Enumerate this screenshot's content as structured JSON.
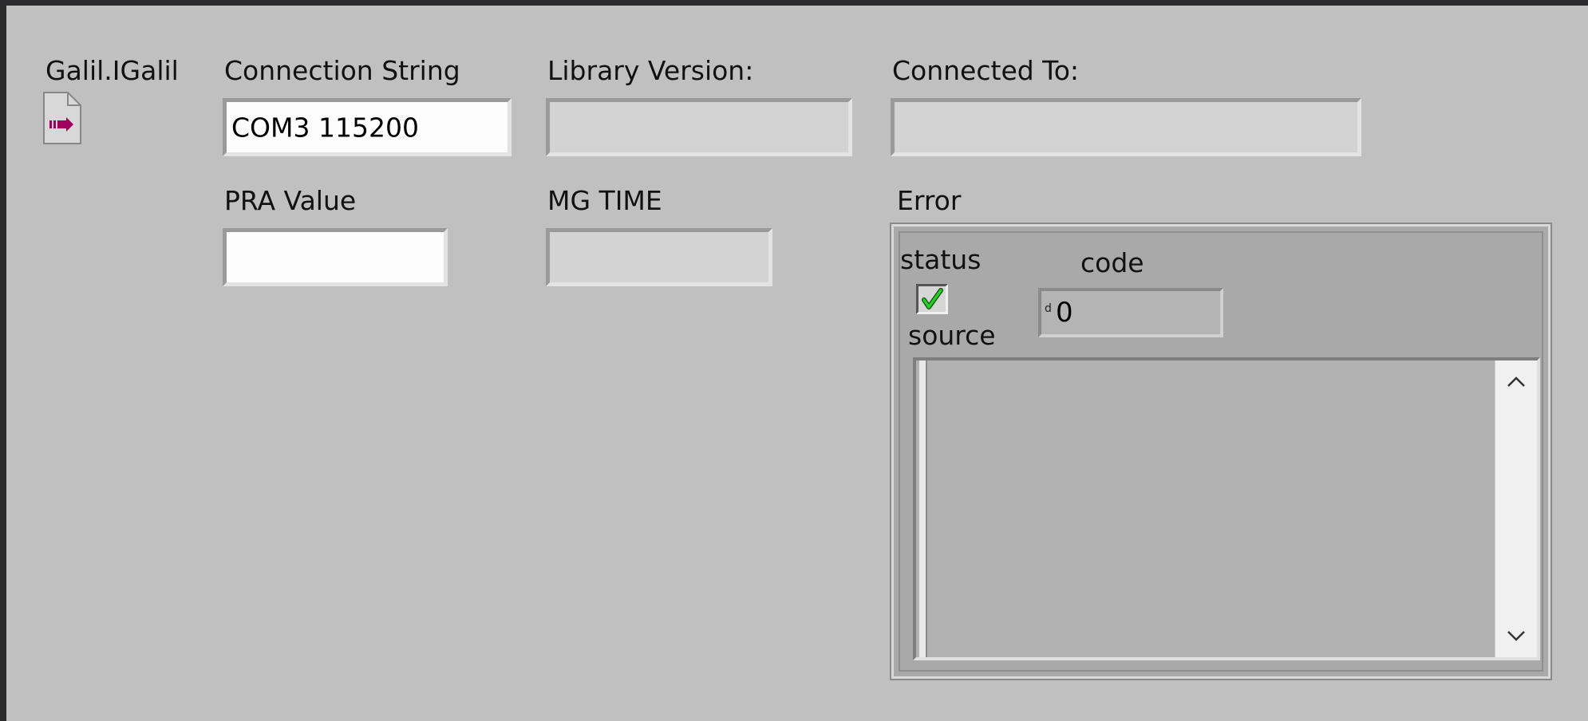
{
  "refnum": {
    "label": "Galil.IGalil",
    "icon": "refnum-arrow-icon",
    "icon_color": "#a1005f"
  },
  "connection_string": {
    "label": "Connection String",
    "value": "COM3 115200"
  },
  "library_version": {
    "label": "Library Version:",
    "value": ""
  },
  "connected_to": {
    "label": "Connected To:",
    "value": ""
  },
  "pra_value": {
    "label": "PRA Value",
    "value": ""
  },
  "mg_time": {
    "label": "MG TIME",
    "value": ""
  },
  "error": {
    "label": "Error",
    "status_label": "status",
    "status_checked": true,
    "status_color": "#1fd21f",
    "code_label": "code",
    "code_radix": "d",
    "code_value": "0",
    "source_label": "source",
    "source_value": ""
  }
}
